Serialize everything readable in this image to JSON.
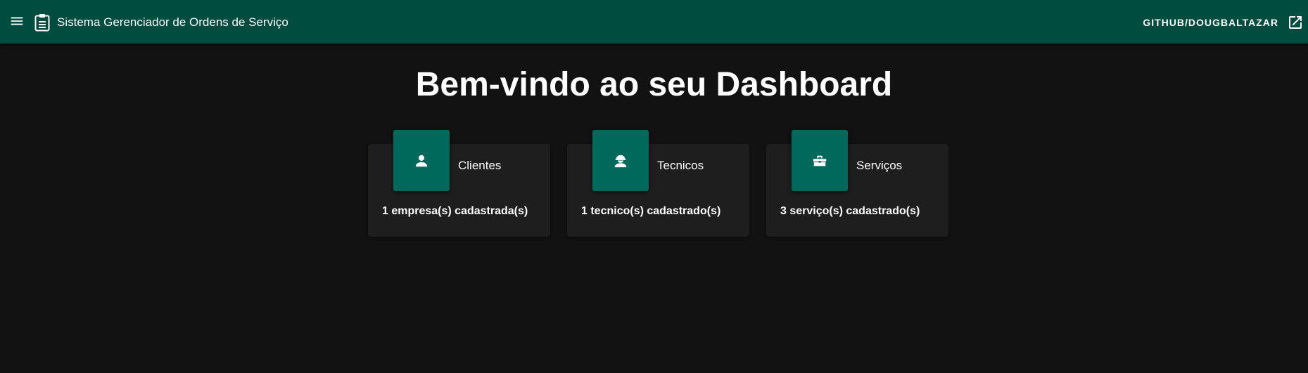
{
  "header": {
    "title": "Sistema Gerenciador de Ordens de Serviço",
    "github_link": "GITHUB/DOUGBALTAZAR",
    "menu_icon": "menu-icon",
    "title_icon": "clipboard-icon",
    "link_icon": "open-in-new-icon",
    "background_color": "#004d40"
  },
  "main": {
    "title": "Bem-vindo ao seu Dashboard",
    "cards": [
      {
        "label": "Clientes",
        "count_text": "1 empresa(s) cadastrada(s)",
        "icon": "person-icon"
      },
      {
        "label": "Tecnicos",
        "count_text": "1 tecnico(s) cadastrado(s)",
        "icon": "engineer-icon"
      },
      {
        "label": "Serviços",
        "count_text": "3 serviço(s) cadastrado(s)",
        "icon": "toolbox-icon"
      }
    ],
    "accent_color": "#00695c",
    "card_background": "#1e1e1e",
    "page_background": "#121212"
  }
}
